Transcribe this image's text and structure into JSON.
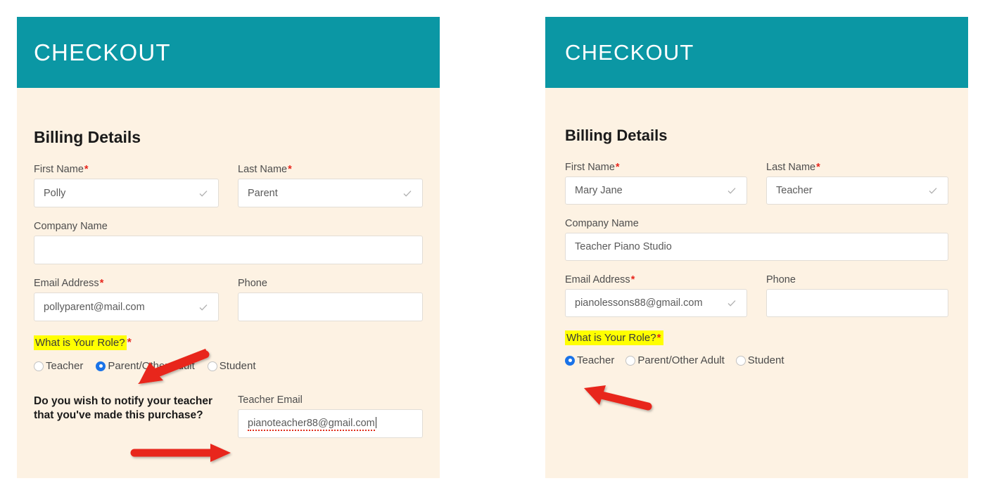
{
  "panels": [
    {
      "id": "left",
      "header_title": "CHECKOUT",
      "section_title": "Billing Details",
      "fields": {
        "first_name_label": "First Name",
        "first_name_value": "Polly",
        "last_name_label": "Last Name",
        "last_name_value": "Parent",
        "company_label": "Company Name",
        "company_value": "",
        "email_label": "Email Address",
        "email_value": "pollyparent@mail.com",
        "phone_label": "Phone",
        "phone_value": ""
      },
      "role": {
        "label": "What is Your Role?",
        "options": [
          "Teacher",
          "Parent/Other Adult",
          "Student"
        ],
        "selected": "Parent/Other Adult"
      },
      "notify": {
        "question": "Do you wish to notify your teacher that you've made this purchase?",
        "teacher_email_label": "Teacher Email",
        "teacher_email_value": "pianoteacher88@gmail.com"
      }
    },
    {
      "id": "right",
      "header_title": "CHECKOUT",
      "section_title": "Billing Details",
      "fields": {
        "first_name_label": "First Name",
        "first_name_value": "Mary Jane",
        "last_name_label": "Last Name",
        "last_name_value": "Teacher",
        "company_label": "Company Name",
        "company_value": "Teacher Piano Studio",
        "email_label": "Email Address",
        "email_value": "pianolessons88@gmail.com",
        "phone_label": "Phone",
        "phone_value": ""
      },
      "role": {
        "label": "What is Your Role?",
        "options": [
          "Teacher",
          "Parent/Other Adult",
          "Student"
        ],
        "selected": "Teacher"
      }
    }
  ],
  "marks": {
    "required_symbol": "*",
    "check_icon": "checkmark-icon",
    "annotation_arrows": [
      {
        "name": "arrow-to-parent-radio",
        "color": "#e8271a"
      },
      {
        "name": "arrow-to-teacher-email",
        "color": "#e8271a"
      },
      {
        "name": "arrow-to-teacher-radio",
        "color": "#e8271a"
      }
    ]
  },
  "colors": {
    "header_teal": "#0b97a4",
    "panel_cream": "#fdf2e3",
    "required_red": "#e8261c",
    "highlight_yellow": "#ffff00",
    "radio_selected_blue": "#1a73e8",
    "arrow_red": "#e8271a"
  }
}
